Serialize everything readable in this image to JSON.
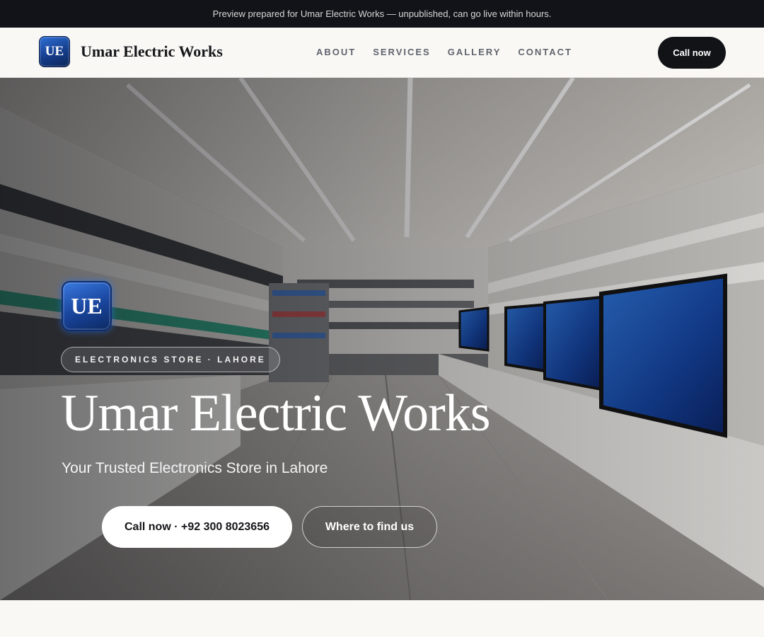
{
  "banner": {
    "text": "Preview prepared for Umar Electric Works — unpublished, can go live within hours."
  },
  "nav": {
    "logo_text": "UE",
    "brand_name": "Umar Electric Works",
    "links": [
      "ABOUT",
      "SERVICES",
      "GALLERY",
      "CONTACT"
    ],
    "cta_label": "Call now"
  },
  "hero": {
    "logo_text": "UE",
    "tag": "ELECTRONICS STORE · LAHORE",
    "title": "Umar Electric Works",
    "subtitle": "Your Trusted Electronics Store in Lahore",
    "primary_button": "Call now · +92 300 8023656",
    "secondary_button": "Where to find us"
  },
  "colors": {
    "banner_bg": "#111318",
    "page_bg": "#f9f8f5",
    "cta_bg": "#121317",
    "logo_blue": "#1a47a0"
  }
}
